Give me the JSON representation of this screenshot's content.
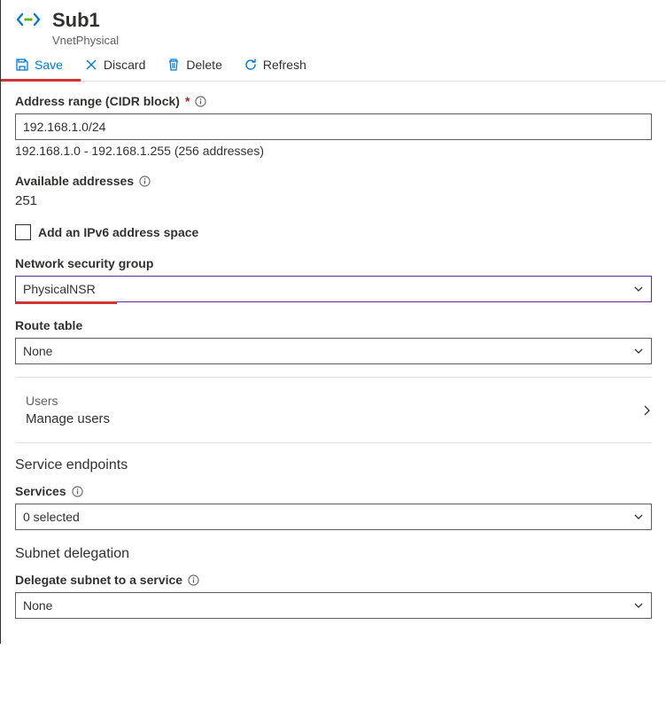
{
  "header": {
    "title": "Sub1",
    "subtitle": "VnetPhysical"
  },
  "toolbar": {
    "save": "Save",
    "discard": "Discard",
    "delete": "Delete",
    "refresh": "Refresh"
  },
  "addressRange": {
    "label": "Address range (CIDR block)",
    "required": "*",
    "value": "192.168.1.0/24",
    "hint": "192.168.1.0 - 192.168.1.255 (256 addresses)"
  },
  "availableAddresses": {
    "label": "Available addresses",
    "value": "251"
  },
  "ipv6": {
    "label": "Add an IPv6 address space"
  },
  "nsg": {
    "label": "Network security group",
    "value": "PhysicalNSR"
  },
  "routeTable": {
    "label": "Route table",
    "value": "None"
  },
  "usersDrill": {
    "title": "Users",
    "subtitle": "Manage users"
  },
  "serviceEndpoints": {
    "heading": "Service endpoints",
    "servicesLabel": "Services",
    "servicesValue": "0 selected"
  },
  "subnetDelegation": {
    "heading": "Subnet delegation",
    "delegateLabel": "Delegate subnet to a service",
    "delegateValue": "None"
  }
}
